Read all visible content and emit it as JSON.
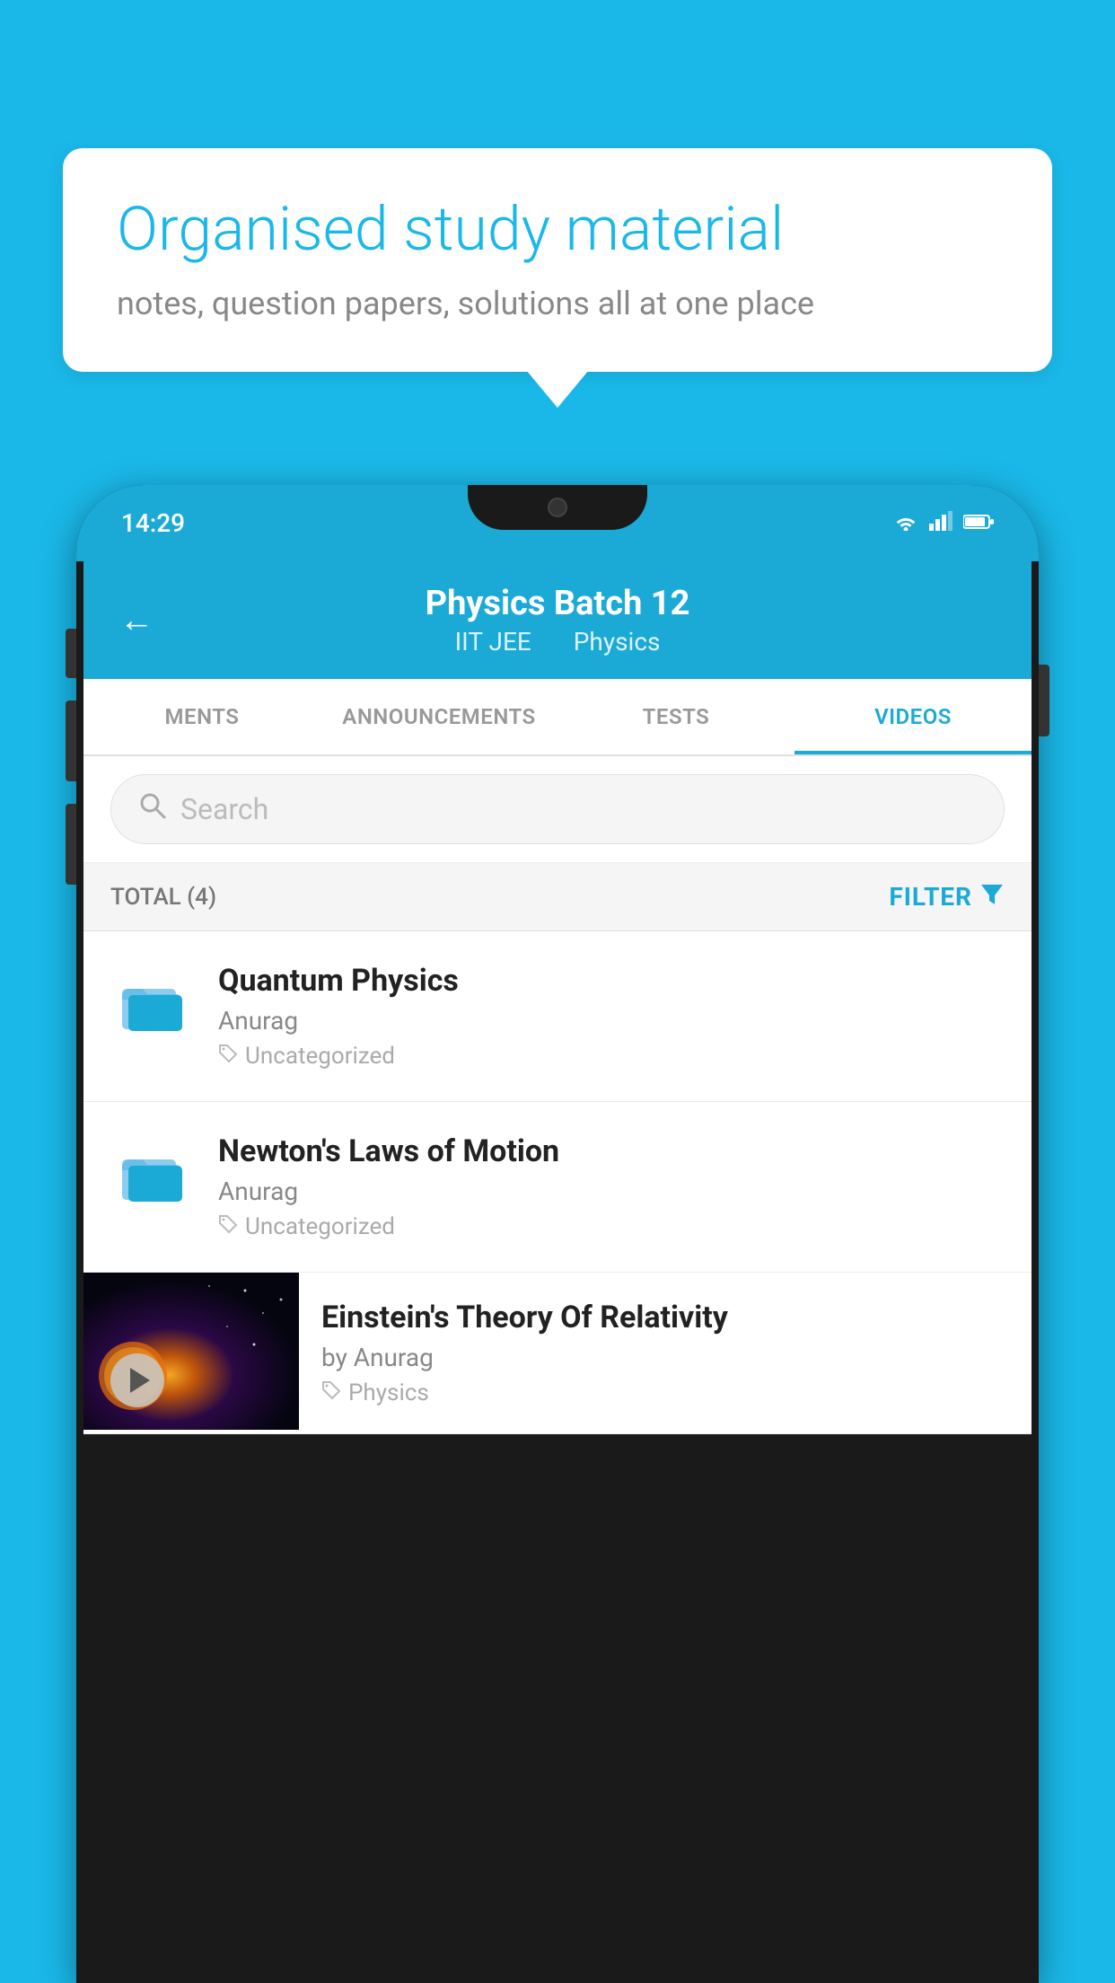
{
  "background_color": "#1ab8e8",
  "bubble": {
    "title": "Organised study material",
    "subtitle": "notes, question papers, solutions all at one place"
  },
  "phone": {
    "status_bar": {
      "time": "14:29",
      "wifi": "▾",
      "signal": "◂",
      "battery": "▮"
    },
    "header": {
      "title": "Physics Batch 12",
      "subtitle_part1": "IIT JEE",
      "subtitle_part2": "Physics",
      "back_label": "←"
    },
    "tabs": [
      {
        "label": "MENTS",
        "active": false
      },
      {
        "label": "ANNOUNCEMENTS",
        "active": false
      },
      {
        "label": "TESTS",
        "active": false
      },
      {
        "label": "VIDEOS",
        "active": true
      }
    ],
    "search": {
      "placeholder": "Search"
    },
    "filter_bar": {
      "total_label": "TOTAL (4)",
      "filter_label": "FILTER"
    },
    "videos": [
      {
        "id": 1,
        "title": "Quantum Physics",
        "author": "Anurag",
        "category": "Uncategorized",
        "has_thumbnail": false
      },
      {
        "id": 2,
        "title": "Newton's Laws of Motion",
        "author": "Anurag",
        "category": "Uncategorized",
        "has_thumbnail": false
      },
      {
        "id": 3,
        "title": "Einstein's Theory Of Relativity",
        "author": "by Anurag",
        "category": "Physics",
        "has_thumbnail": true
      }
    ]
  }
}
